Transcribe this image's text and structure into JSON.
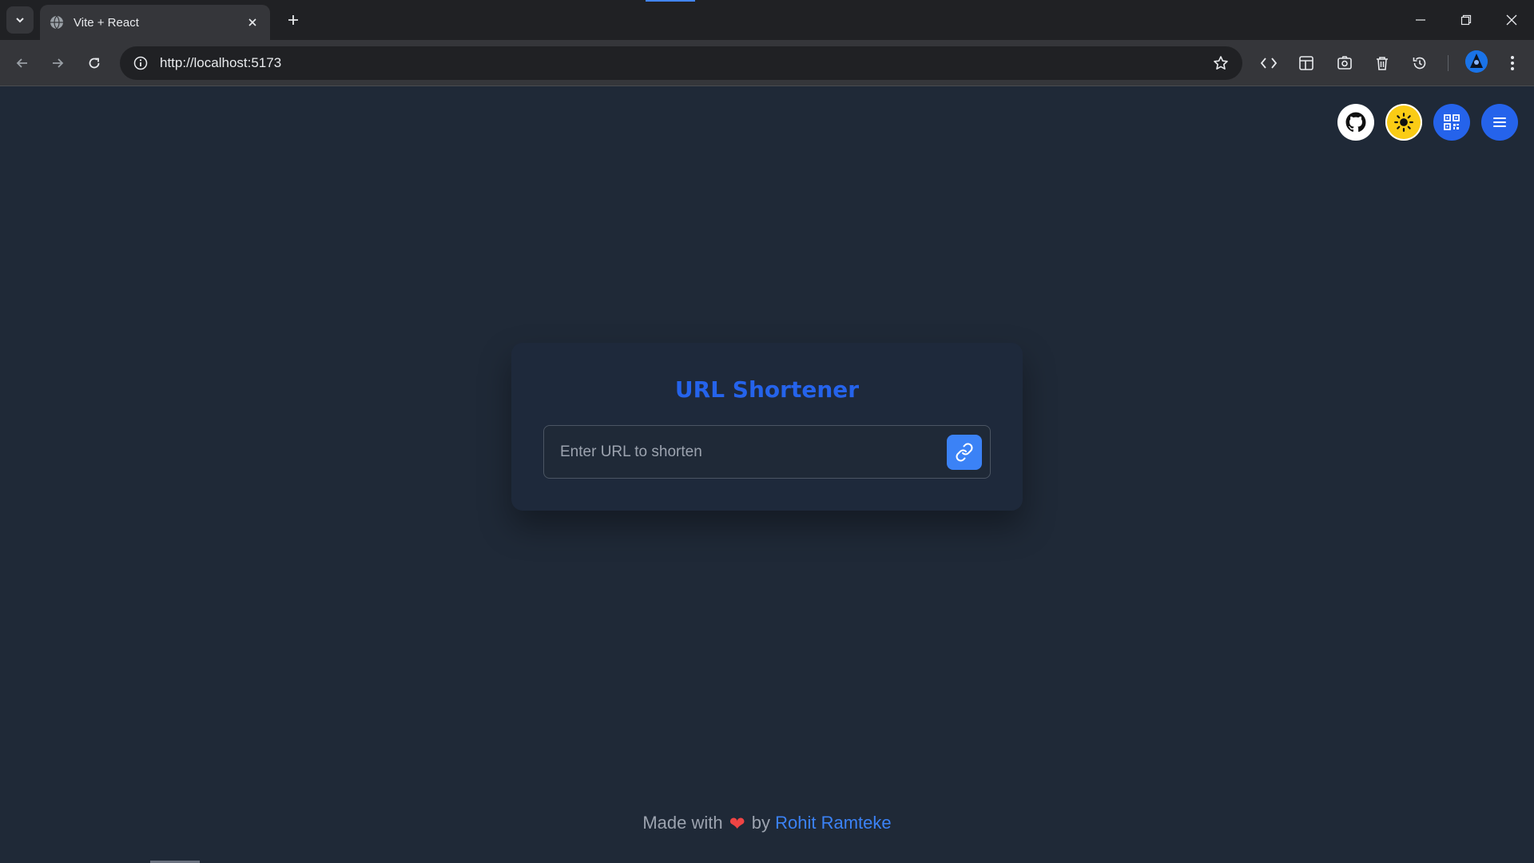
{
  "browser": {
    "tab_title": "Vite + React",
    "url": "http://localhost:5173",
    "accent": "#4285f4"
  },
  "page": {
    "icons": [
      "github-icon",
      "sun-icon",
      "qr-code-icon",
      "menu-icon"
    ],
    "title": "URL Shortener",
    "input_placeholder": "Enter URL to shorten",
    "input_value": "",
    "footer": {
      "prefix": "Made with",
      "heart": "❤",
      "by": "by",
      "author": "Rohit Ramteke"
    }
  },
  "colors": {
    "background": "#1f2937",
    "card": "#1e293b",
    "primary": "#2563eb",
    "theme_toggle": "#facc15",
    "heart": "#ef4444"
  }
}
